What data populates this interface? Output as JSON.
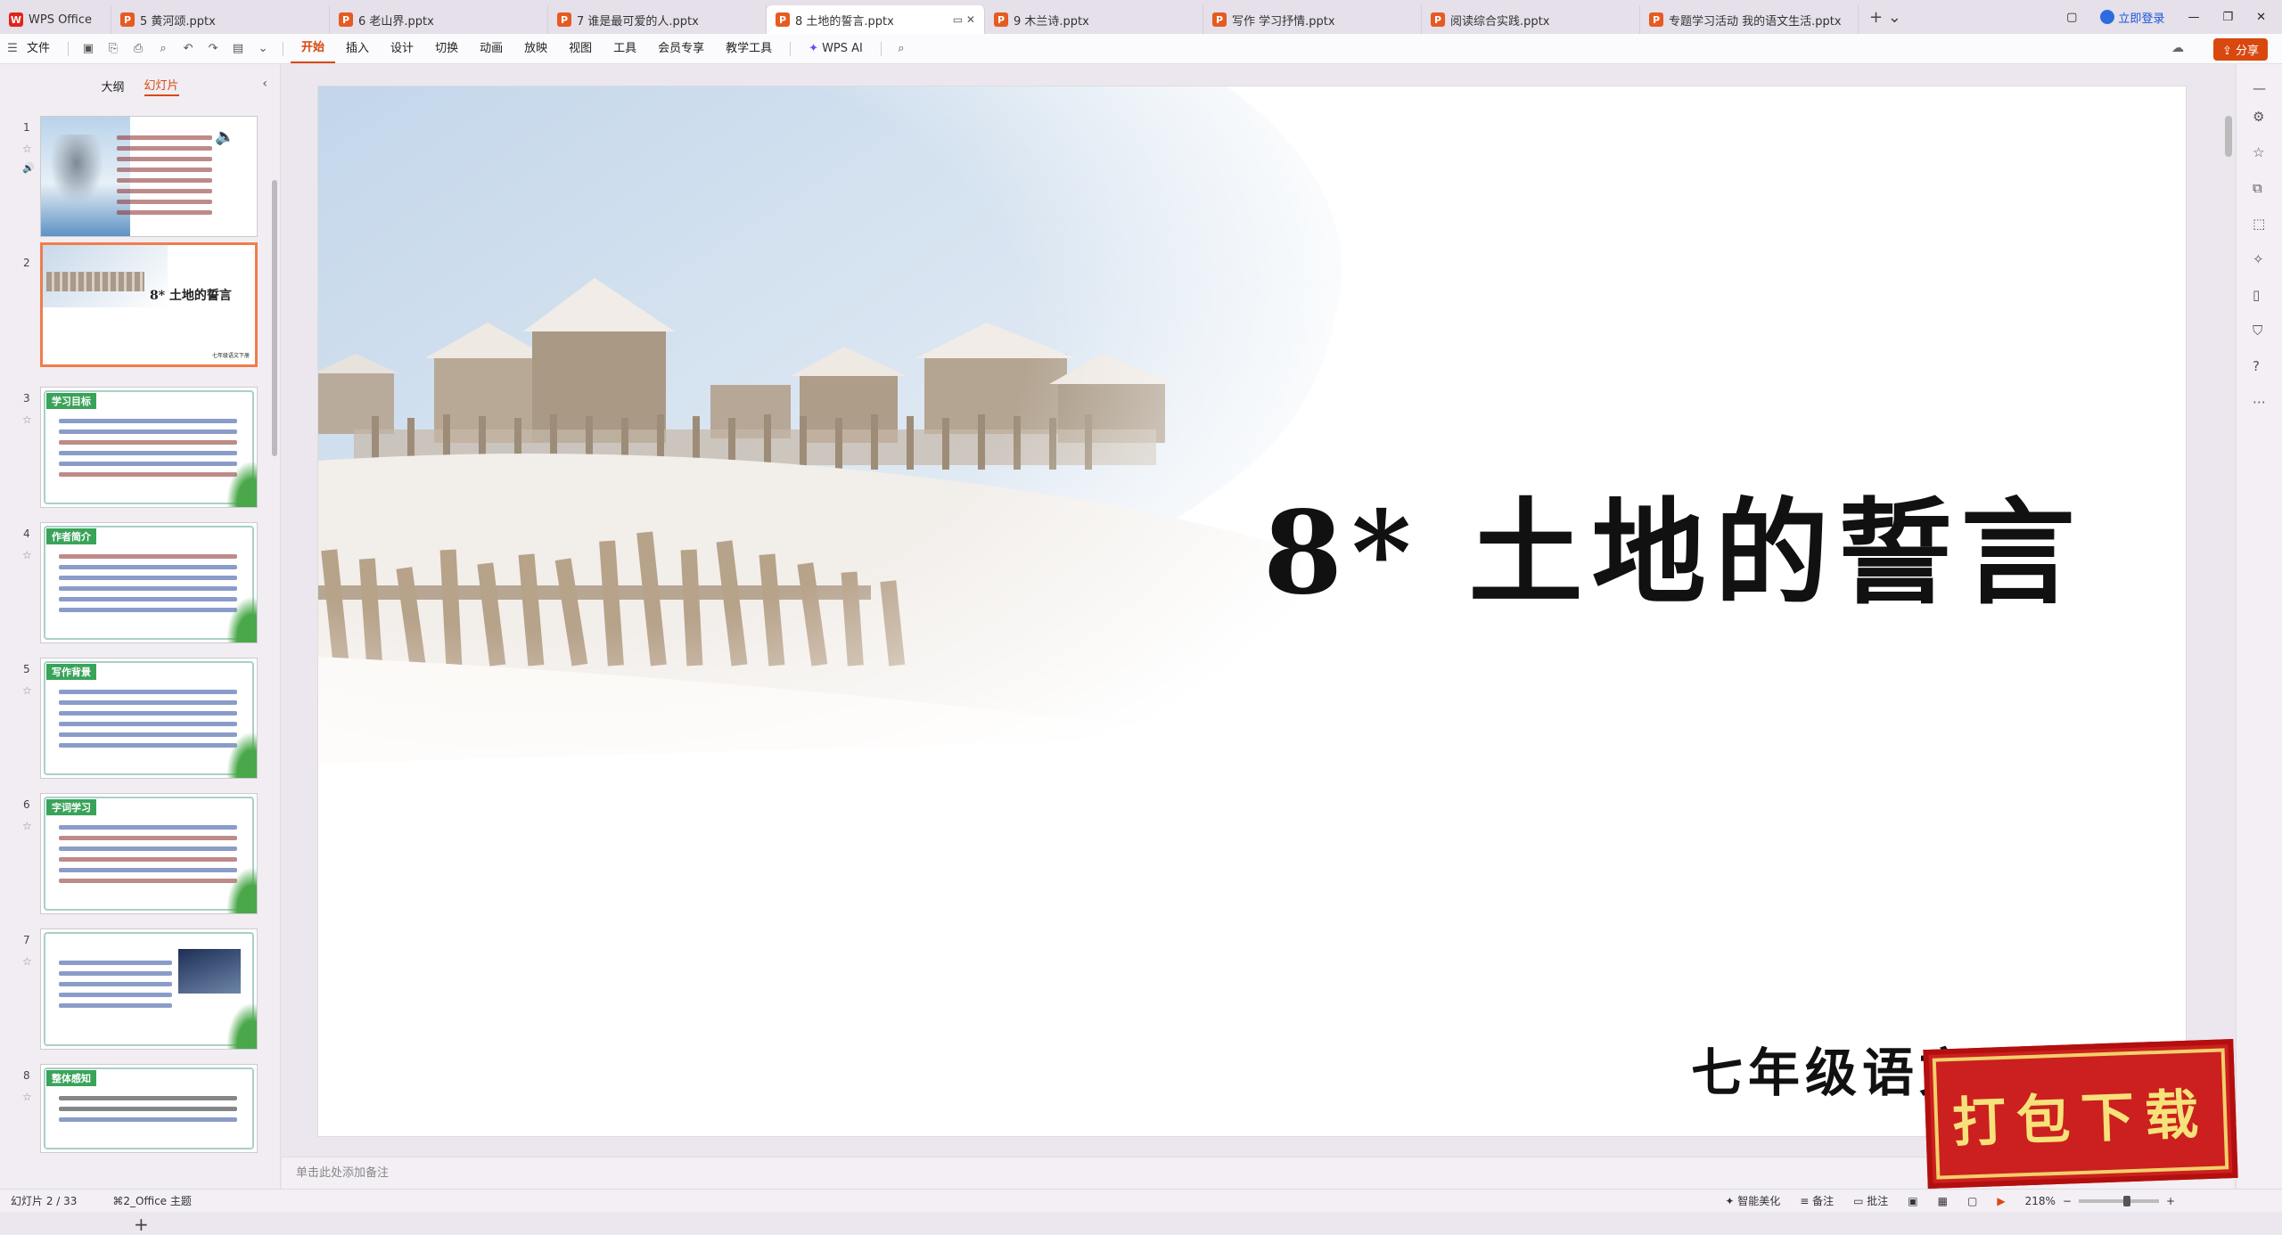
{
  "tabs": {
    "home": "WPS Office",
    "files": [
      "5 黄河颂.pptx",
      "6 老山界.pptx",
      "7 谁是最可爱的人.pptx",
      "8 土地的誓言.pptx",
      "9 木兰诗.pptx",
      "写作 学习抒情.pptx",
      "阅读综合实践.pptx",
      "专题学习活动 我的语文生活.pptx"
    ],
    "login": "立即登录"
  },
  "menu": {
    "file": "文件",
    "items": [
      "开始",
      "插入",
      "设计",
      "切换",
      "动画",
      "放映",
      "视图",
      "工具",
      "会员专享",
      "教学工具"
    ],
    "wps_ai": "WPS AI",
    "share": "分享"
  },
  "sidebar": {
    "tab_outline": "大纲",
    "tab_slides": "幻灯片",
    "slides": [
      {
        "num": "1",
        "band": "",
        "lines": 8
      },
      {
        "num": "2",
        "band": "",
        "title": "8* 土地的誓言",
        "sub": "七年级语文下册"
      },
      {
        "num": "3",
        "band": "学习目标",
        "lines": 6
      },
      {
        "num": "4",
        "band": "作者简介",
        "lines": 7
      },
      {
        "num": "5",
        "band": "写作背景",
        "lines": 7
      },
      {
        "num": "6",
        "band": "字词学习",
        "lines": 7
      },
      {
        "num": "7",
        "band": "",
        "lines": 8
      },
      {
        "num": "8",
        "band": "整体感知",
        "lines": 3
      }
    ]
  },
  "slide": {
    "title": "8*  土地的誓言",
    "subtitle": "七年级语文下册"
  },
  "stamp": "打包下载",
  "notes_placeholder": "单击此处添加备注",
  "status": {
    "slide_pos": "幻灯片 2 / 33",
    "theme": "2_Office 主题",
    "smart": "智能美化",
    "notes": "备注",
    "comments": "批注",
    "zoom": "218%"
  },
  "colors": {
    "accent": "#d9480f",
    "stamp": "#cc1f1f"
  }
}
